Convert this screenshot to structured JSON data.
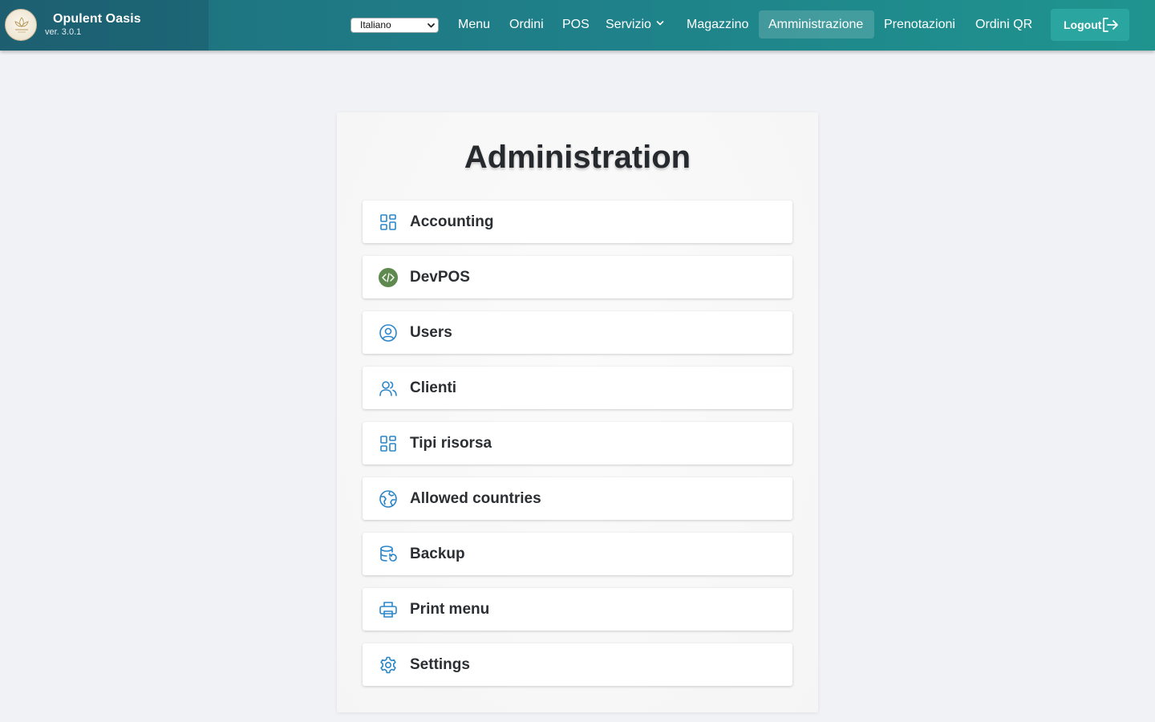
{
  "brand": {
    "name": "Opulent Oasis",
    "version": "ver. 3.0.1"
  },
  "language_select": {
    "selected": "Italiano"
  },
  "nav": {
    "items": [
      {
        "label": "Menu"
      },
      {
        "label": "Ordini"
      },
      {
        "label": "POS"
      },
      {
        "label": "Servizio"
      },
      {
        "label": "Magazzino"
      },
      {
        "label": "Amministrazione",
        "active": true
      },
      {
        "label": "Prenotazioni"
      },
      {
        "label": "Ordini QR"
      }
    ],
    "logout_label": "Logout"
  },
  "admin": {
    "title": "Administration",
    "items": [
      {
        "label": "Accounting",
        "icon": "grid-icon"
      },
      {
        "label": "DevPOS",
        "icon": "devpos-code-icon"
      },
      {
        "label": "Users",
        "icon": "user-circle-icon"
      },
      {
        "label": "Clienti",
        "icon": "users-icon"
      },
      {
        "label": "Tipi risorsa",
        "icon": "grid-icon"
      },
      {
        "label": "Allowed countries",
        "icon": "globe-icon"
      },
      {
        "label": "Backup",
        "icon": "database-restore-icon"
      },
      {
        "label": "Print menu",
        "icon": "printer-icon"
      },
      {
        "label": "Settings",
        "icon": "gear-icon"
      }
    ]
  },
  "colors": {
    "navbar_start": "#1e6f7c",
    "navbar_end": "#1f948f",
    "logout_bg": "#2aa5a0",
    "icon_blue": "#2a86c8",
    "devpos_green": "#5f8a4f",
    "page_bg": "#f1f2f5"
  }
}
